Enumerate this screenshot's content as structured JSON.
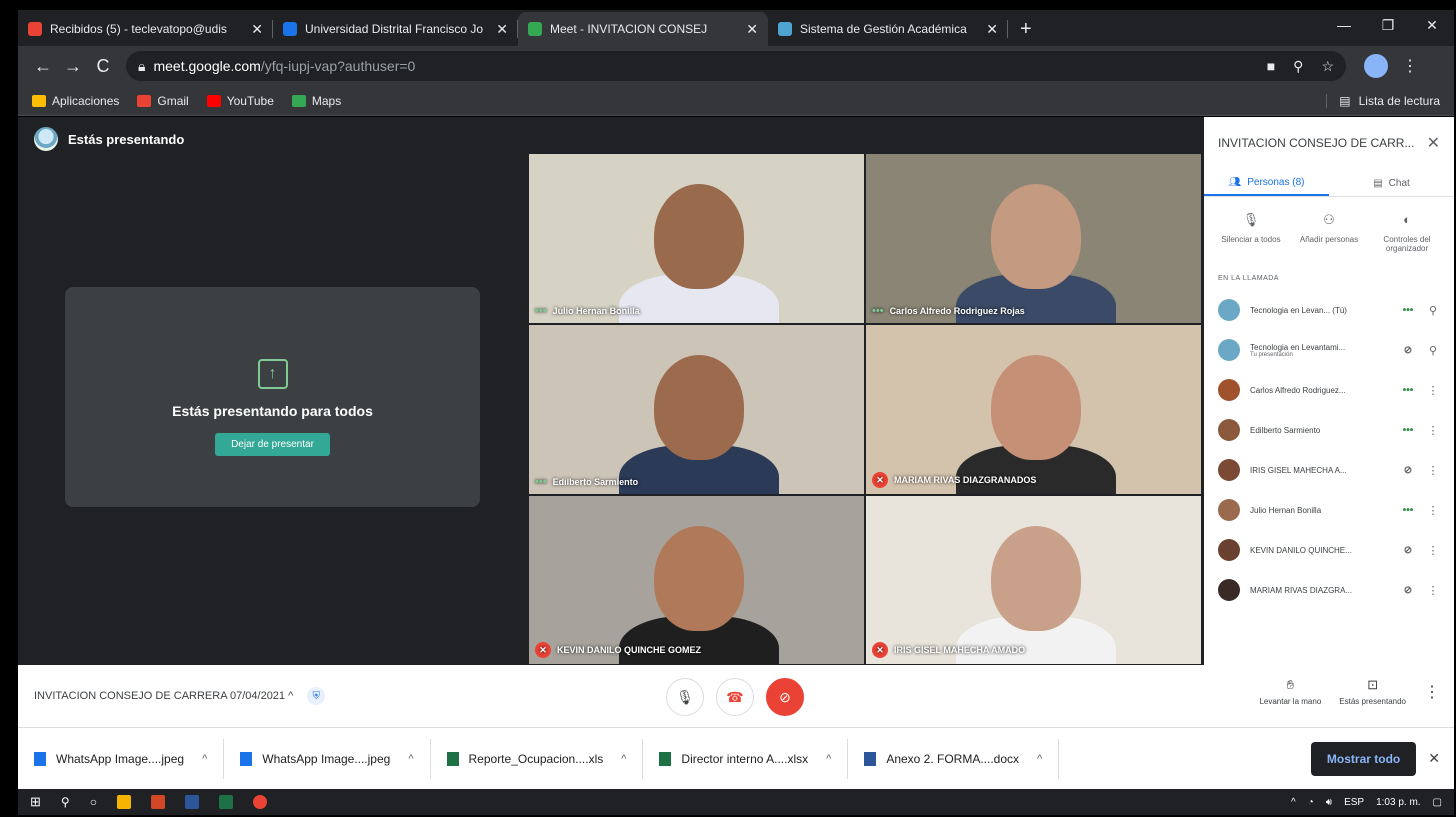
{
  "browser": {
    "tabs": [
      {
        "title": "Recibidos (5) - teclevatopo@udis",
        "color": "#ea4335",
        "active": false
      },
      {
        "title": "Universidad Distrital Francisco Jo",
        "color": "#1a73e8",
        "active": false
      },
      {
        "title": "Meet - INVITACION CONSEJ",
        "color": "#34a853",
        "active": true
      },
      {
        "title": "Sistema de Gestión Académica",
        "color": "#4fa3d1",
        "active": false
      }
    ],
    "new_tab": "+",
    "window": {
      "minimize": "—",
      "restore": "❐",
      "close": "✕"
    },
    "url_host": "meet.google.com",
    "url_path": "/yfq-iupj-vap?authuser=0",
    "bookmarks": [
      {
        "label": "Aplicaciones",
        "color": "#fbbc04"
      },
      {
        "label": "Gmail",
        "color": "#ea4335"
      },
      {
        "label": "YouTube",
        "color": "#ff0000"
      },
      {
        "label": "Maps",
        "color": "#34a853"
      }
    ],
    "reading_list": "Lista de lectura"
  },
  "meet": {
    "presenting_header": "Estás presentando",
    "presenting_message": "Estás presentando para todos",
    "stop_button": "Dejar de presentar",
    "tiles": [
      {
        "name": "Julio Hernan Bonilla",
        "status": "speaking",
        "bg": "#d6d2c4",
        "skin": "#9a6a4c",
        "shirt": "#e7e7f2"
      },
      {
        "name": "Carlos Alfredo Rodriguez Rojas",
        "status": "speaking",
        "bg": "#8a8575",
        "skin": "#c49a80",
        "shirt": "#3b4a66"
      },
      {
        "name": "Edilberto Sarmiento",
        "status": "speaking",
        "bg": "#cdc4b8",
        "skin": "#9c6b4e",
        "shirt": "#2b3a57"
      },
      {
        "name": "MARIAM RIVAS DIAZGRANADOS",
        "status": "muted",
        "bg": "#d3c3ad",
        "skin": "#c69077",
        "shirt": "#2a2a2a"
      },
      {
        "name": "KEVIN DANILO QUINCHE GOMEZ",
        "status": "muted",
        "bg": "#a7a39c",
        "skin": "#b07a5a",
        "shirt": "#1f1f1f"
      },
      {
        "name": "IRIS GISEL MAHECHA AMADO",
        "status": "muted",
        "bg": "#e8e4dc",
        "skin": "#c9a18a",
        "shirt": "#f2f2f2"
      }
    ],
    "meeting_title": "INVITACION CONSEJO DE CARRERA 07/04/2021 ^",
    "controls": {
      "raise_hand": "Levantar la mano",
      "presenting": "Estás presentando"
    }
  },
  "panel": {
    "title": "INVITACION CONSEJO DE CARR...",
    "tabs": {
      "people": "Personas (8)",
      "chat": "Chat"
    },
    "actions": {
      "mute_all": "Silenciar a todos",
      "add_people": "Añadir personas",
      "host_controls": "Controles del organizador"
    },
    "section": "EN LA LLAMADA",
    "participants": [
      {
        "name": "Tecnologia en Levan... (Tú)",
        "sub": "",
        "status": "speaking",
        "avatar": "#6aa8c6",
        "menu": "pin"
      },
      {
        "name": "Tecnologia en Levantami...",
        "sub": "Tu presentación",
        "status": "present",
        "avatar": "#6aa8c6",
        "menu": "pin"
      },
      {
        "name": "Carlos Alfredo Rodriguez...",
        "sub": "",
        "status": "speaking",
        "avatar": "#a0522d",
        "menu": "more"
      },
      {
        "name": "Edilberto Sarmiento",
        "sub": "",
        "status": "speaking",
        "avatar": "#8b5a3c",
        "menu": "more"
      },
      {
        "name": "IRIS GISEL MAHECHA A...",
        "sub": "",
        "status": "muted",
        "avatar": "#7b4a35",
        "menu": "more"
      },
      {
        "name": "Julio Hernan Bonilla",
        "sub": "",
        "status": "speaking",
        "avatar": "#9a6a4c",
        "menu": "more"
      },
      {
        "name": "KEVIN DANILO QUINCHE...",
        "sub": "",
        "status": "muted",
        "avatar": "#6a4030",
        "menu": "more"
      },
      {
        "name": "MARIAM RIVAS DIAZGRA...",
        "sub": "",
        "status": "muted",
        "avatar": "#3a2a25",
        "menu": "more"
      }
    ]
  },
  "downloads": {
    "items": [
      {
        "name": "WhatsApp Image....jpeg",
        "color": "#1a73e8"
      },
      {
        "name": "WhatsApp Image....jpeg",
        "color": "#1a73e8"
      },
      {
        "name": "Reporte_Ocupacion....xls",
        "color": "#1e7145"
      },
      {
        "name": "Director interno A....xlsx",
        "color": "#1e7145"
      },
      {
        "name": "Anexo 2. FORMA....docx",
        "color": "#2b579a"
      }
    ],
    "show_all": "Mostrar todo"
  },
  "taskbar": {
    "lang": "ESP",
    "time": "1:03 p. m."
  }
}
